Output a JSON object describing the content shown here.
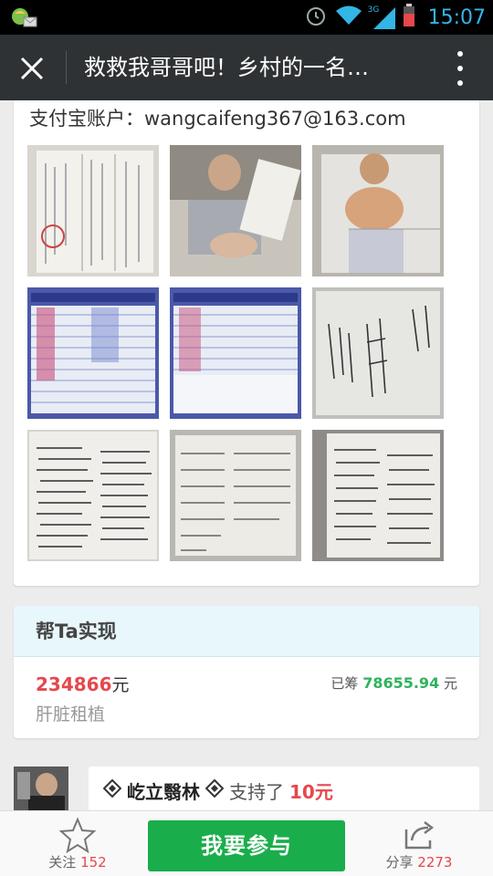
{
  "status_bar": {
    "time": "15:07",
    "network": "3G"
  },
  "header": {
    "title": "救救我哥哥吧！乡村的一名…"
  },
  "content": {
    "account_text": "支付宝账户：wangcaifeng367@163.com",
    "photos": [
      "document-scan-photo",
      "patient-in-bed-photo",
      "patient-lying-photo",
      "hospital-bill-screen-photo",
      "hospital-bill-screen-photo",
      "handwritten-note-photo",
      "handwritten-notebook-photo",
      "donation-list-photo",
      "handwritten-notebook-photo"
    ]
  },
  "goal": {
    "section_title": "帮Ta实现",
    "target_amount": "234866",
    "currency_unit": "元",
    "raised_label": "已筹",
    "raised_amount": "78655.94",
    "purpose": "肝脏租植"
  },
  "supporter": {
    "name": "屹立翳林",
    "action": "支持了",
    "amount": "10元"
  },
  "bottom_bar": {
    "follow_label": "关注",
    "follow_count": "152",
    "join_label": "我要参与",
    "share_label": "分享",
    "share_count": "2273"
  },
  "colors": {
    "accent_green": "#1aad4b",
    "accent_red": "#e5484d",
    "status_blue": "#33b5e5"
  }
}
